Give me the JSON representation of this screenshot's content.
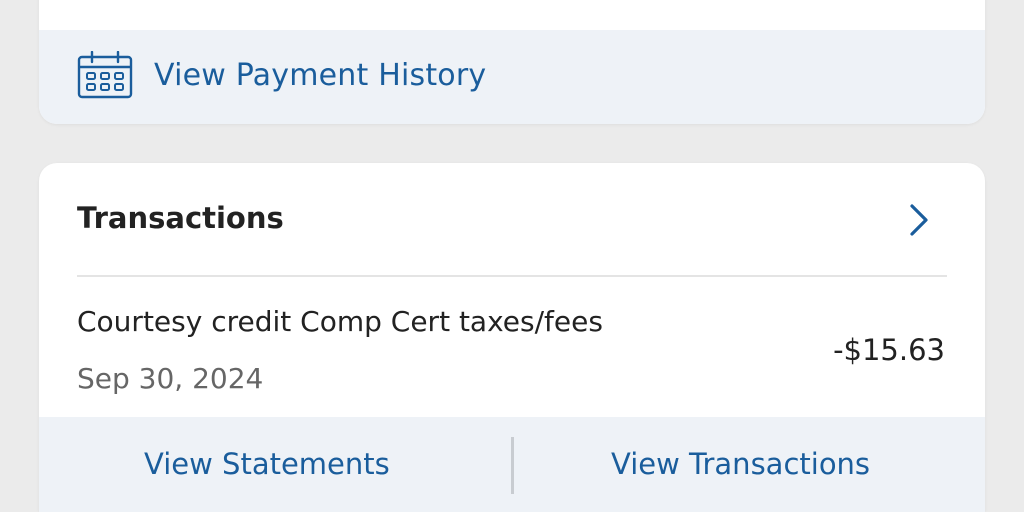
{
  "payment_card": {
    "history_label": "View Payment History",
    "icon": "calendar-icon"
  },
  "transactions_card": {
    "title": "Transactions",
    "header_icon": "chevron-right-icon",
    "items": [
      {
        "description": "Courtesy credit Comp Cert taxes/fees",
        "date": "Sep 30, 2024",
        "amount": "-$15.63"
      }
    ],
    "footer": {
      "statements_label": "View Statements",
      "transactions_label": "View Transactions"
    }
  },
  "colors": {
    "accent": "#1a5d9c",
    "background": "#ebebeb",
    "card": "#ffffff",
    "bar": "#eef2f7",
    "text": "#222222",
    "muted": "#666666"
  }
}
